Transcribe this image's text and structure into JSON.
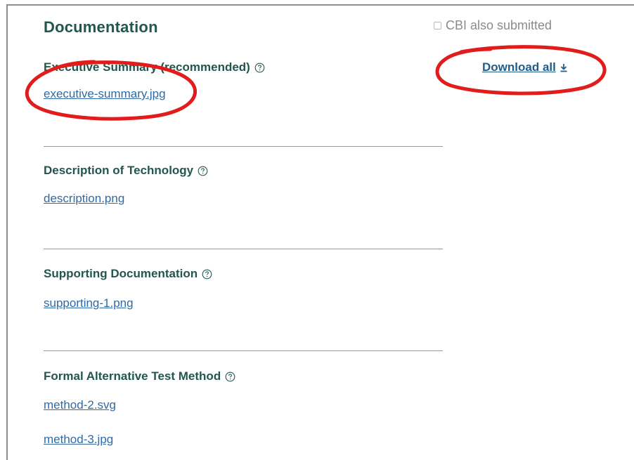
{
  "header": {
    "title": "Documentation",
    "cbi_label": "CBI also submitted",
    "cbi_checked": false,
    "download_all_label": "Download all"
  },
  "sections": [
    {
      "label": "Executive Summary (recommended)",
      "files": [
        "executive-summary.jpg"
      ]
    },
    {
      "label": "Description of Technology",
      "files": [
        "description.png"
      ]
    },
    {
      "label": "Supporting Documentation",
      "files": [
        "supporting-1.png"
      ]
    },
    {
      "label": "Formal Alternative Test Method",
      "files": [
        "method-2.svg",
        "method-3.jpg"
      ]
    }
  ],
  "colors": {
    "heading": "#20584f",
    "link": "#2f6aa4",
    "annotation": "#e21b1b"
  },
  "icons": [
    "help-circle-icon",
    "download-icon",
    "checkbox-icon"
  ]
}
